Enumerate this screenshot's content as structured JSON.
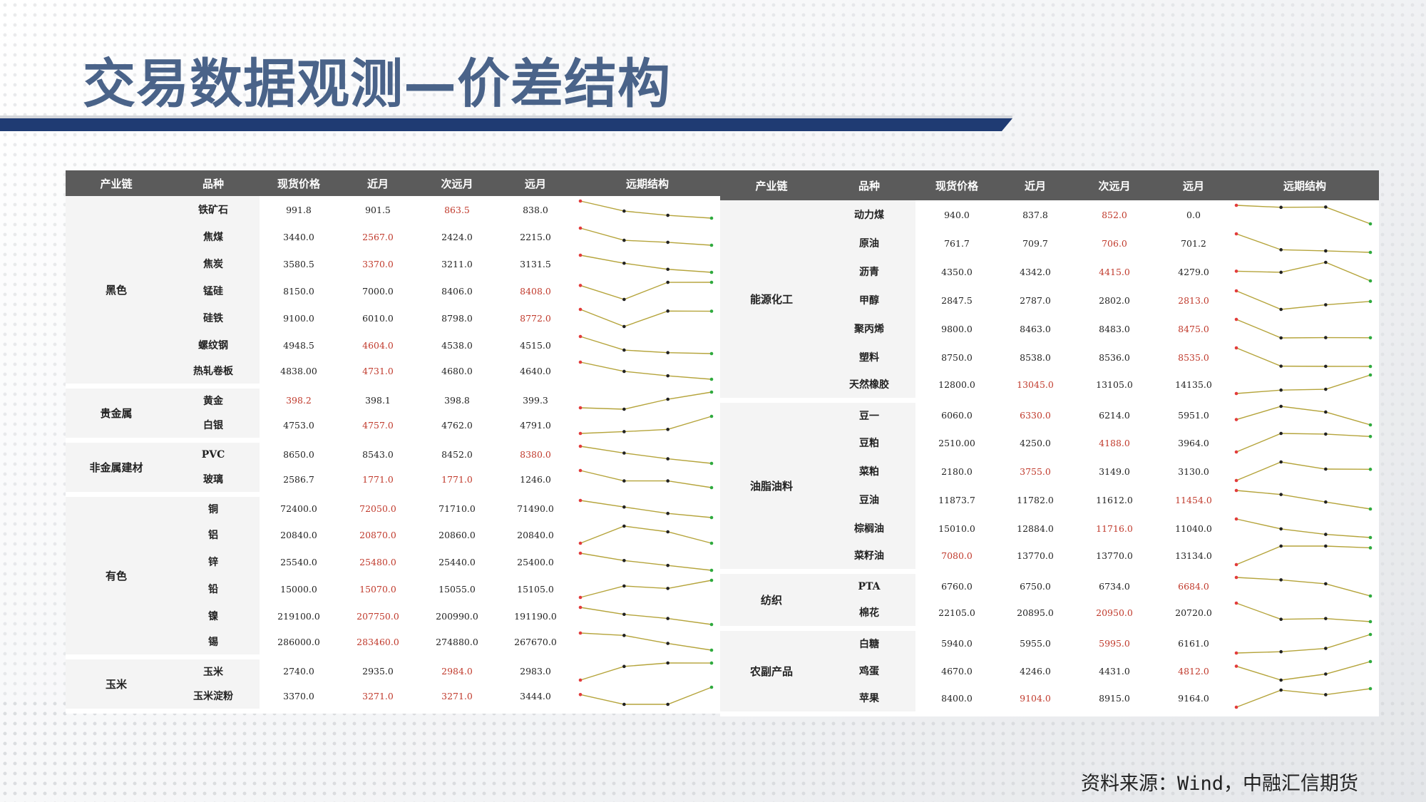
{
  "title": "交易数据观测—价差结构",
  "source": "资料来源：Wind，中融汇信期货",
  "colors": {
    "title": "#4a6389",
    "bar": "#1f3b73",
    "header": "#5b5b5b",
    "highlight": "#c0392b",
    "line": "#b5a43b",
    "start_dot": "#e23b3b",
    "end_dot": "#2faa3e",
    "mid_dot": "#222222"
  },
  "headers": [
    "产业链",
    "品种",
    "现货价格",
    "近月",
    "次远月",
    "远月",
    "远期结构"
  ],
  "left": {
    "groups": [
      {
        "name": "黑色",
        "rows": [
          {
            "name": "铁矿石",
            "spot": "991.8",
            "near": "901.5",
            "mid": "863.5",
            "far": "838.0",
            "hl": 2
          },
          {
            "name": "焦煤",
            "spot": "3440.0",
            "near": "2567.0",
            "mid": "2424.0",
            "far": "2215.0",
            "hl": 1
          },
          {
            "name": "焦炭",
            "spot": "3580.5",
            "near": "3370.0",
            "mid": "3211.0",
            "far": "3131.5",
            "hl": 1
          },
          {
            "name": "锰硅",
            "spot": "8150.0",
            "near": "7000.0",
            "mid": "8406.0",
            "far": "8408.0",
            "hl": 3
          },
          {
            "name": "硅铁",
            "spot": "9100.0",
            "near": "6010.0",
            "mid": "8798.0",
            "far": "8772.0",
            "hl": 3
          },
          {
            "name": "螺纹钢",
            "spot": "4948.5",
            "near": "4604.0",
            "mid": "4538.0",
            "far": "4515.0",
            "hl": 1
          },
          {
            "name": "热轧卷板",
            "spot": "4838.00",
            "near": "4731.0",
            "mid": "4680.0",
            "far": "4640.0",
            "hl": 1
          }
        ]
      },
      {
        "name": "贵金属",
        "rows": [
          {
            "name": "黄金",
            "spot": "398.2",
            "near": "398.1",
            "mid": "398.8",
            "far": "399.3",
            "hl": 0
          },
          {
            "name": "白银",
            "spot": "4753.0",
            "near": "4757.0",
            "mid": "4762.0",
            "far": "4791.0",
            "hl": 1
          }
        ]
      },
      {
        "name": "非金属建材",
        "rows": [
          {
            "name": "PVC",
            "spot": "8650.0",
            "near": "8543.0",
            "mid": "8452.0",
            "far": "8380.0",
            "hl": 3
          },
          {
            "name": "玻璃",
            "spot": "2586.7",
            "near": "1771.0",
            "mid": "1771.0",
            "far": "1246.0",
            "hl": 12
          }
        ]
      },
      {
        "name": "有色",
        "rows": [
          {
            "name": "铜",
            "spot": "72400.0",
            "near": "72050.0",
            "mid": "71710.0",
            "far": "71490.0",
            "hl": 1
          },
          {
            "name": "铝",
            "spot": "20840.0",
            "near": "20870.0",
            "mid": "20860.0",
            "far": "20840.0",
            "hl": 1
          },
          {
            "name": "锌",
            "spot": "25540.0",
            "near": "25480.0",
            "mid": "25440.0",
            "far": "25400.0",
            "hl": 1
          },
          {
            "name": "铅",
            "spot": "15000.0",
            "near": "15070.0",
            "mid": "15055.0",
            "far": "15105.0",
            "hl": 1
          },
          {
            "name": "镍",
            "spot": "219100.0",
            "near": "207750.0",
            "mid": "200990.0",
            "far": "191190.0",
            "hl": 1
          },
          {
            "name": "锡",
            "spot": "286000.0",
            "near": "283460.0",
            "mid": "274880.0",
            "far": "267670.0",
            "hl": 1
          }
        ]
      },
      {
        "name": "玉米",
        "rows": [
          {
            "name": "玉米",
            "spot": "2740.0",
            "near": "2935.0",
            "mid": "2984.0",
            "far": "2983.0",
            "hl": 2
          },
          {
            "name": "玉米淀粉",
            "spot": "3370.0",
            "near": "3271.0",
            "mid": "3271.0",
            "far": "3444.0",
            "hl": 12
          }
        ]
      }
    ]
  },
  "right": {
    "groups": [
      {
        "name": "能源化工",
        "rows": [
          {
            "name": "动力煤",
            "spot": "940.0",
            "near": "837.8",
            "mid": "852.0",
            "far": "0.0",
            "hl": 2
          },
          {
            "name": "原油",
            "spot": "761.7",
            "near": "709.7",
            "mid": "706.0",
            "far": "701.2",
            "hl": 2
          },
          {
            "name": "沥青",
            "spot": "4350.0",
            "near": "4342.0",
            "mid": "4415.0",
            "far": "4279.0",
            "hl": 2
          },
          {
            "name": "甲醇",
            "spot": "2847.5",
            "near": "2787.0",
            "mid": "2802.0",
            "far": "2813.0",
            "hl": 3
          },
          {
            "name": "聚丙烯",
            "spot": "9800.0",
            "near": "8463.0",
            "mid": "8483.0",
            "far": "8475.0",
            "hl": 3
          },
          {
            "name": "塑料",
            "spot": "8750.0",
            "near": "8538.0",
            "mid": "8536.0",
            "far": "8535.0",
            "hl": 3
          },
          {
            "name": "天然橡胶",
            "spot": "12800.0",
            "near": "13045.0",
            "mid": "13105.0",
            "far": "14135.0",
            "hl": 1
          }
        ]
      },
      {
        "name": "油脂油料",
        "rows": [
          {
            "name": "豆一",
            "spot": "6060.0",
            "near": "6330.0",
            "mid": "6214.0",
            "far": "5951.0",
            "hl": 1
          },
          {
            "name": "豆粕",
            "spot": "2510.00",
            "near": "4250.0",
            "mid": "4188.0",
            "far": "3964.0",
            "hl": 2
          },
          {
            "name": "菜粕",
            "spot": "2180.0",
            "near": "3755.0",
            "mid": "3149.0",
            "far": "3130.0",
            "hl": 1
          },
          {
            "name": "豆油",
            "spot": "11873.7",
            "near": "11782.0",
            "mid": "11612.0",
            "far": "11454.0",
            "hl": 3
          },
          {
            "name": "棕榈油",
            "spot": "15010.0",
            "near": "12884.0",
            "mid": "11716.0",
            "far": "11040.0",
            "hl": 2
          },
          {
            "name": "菜籽油",
            "spot": "7080.0",
            "near": "13770.0",
            "mid": "13770.0",
            "far": "13134.0",
            "hl": 0
          }
        ]
      },
      {
        "name": "纺织",
        "rows": [
          {
            "name": "PTA",
            "spot": "6760.0",
            "near": "6750.0",
            "mid": "6734.0",
            "far": "6684.0",
            "hl": 3
          },
          {
            "name": "棉花",
            "spot": "22105.0",
            "near": "20895.0",
            "mid": "20950.0",
            "far": "20720.0",
            "hl": 2
          }
        ]
      },
      {
        "name": "农副产品",
        "rows": [
          {
            "name": "白糖",
            "spot": "5940.0",
            "near": "5955.0",
            "mid": "5995.0",
            "far": "6161.0",
            "hl": 2
          },
          {
            "name": "鸡蛋",
            "spot": "4670.0",
            "near": "4246.0",
            "mid": "4431.0",
            "far": "4812.0",
            "hl": 3
          },
          {
            "name": "苹果",
            "spot": "8400.0",
            "near": "9104.0",
            "mid": "8915.0",
            "far": "9164.0",
            "hl": 1
          }
        ]
      }
    ]
  }
}
